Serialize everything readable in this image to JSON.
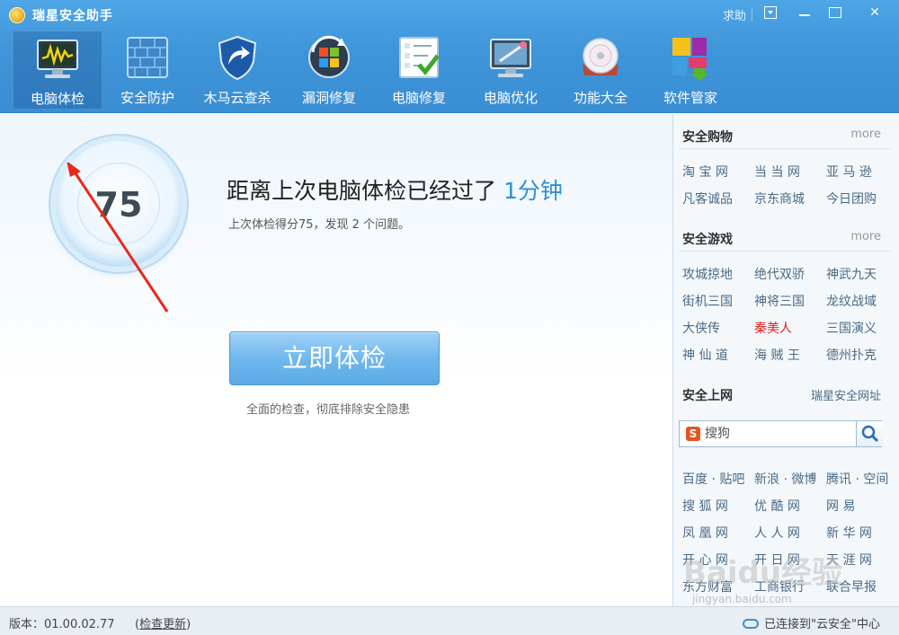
{
  "window": {
    "title": "瑞星安全助手",
    "help_label": "求助"
  },
  "toolbar": {
    "items": [
      {
        "label": "电脑体检",
        "icon": "monitor-checkup-icon"
      },
      {
        "label": "安全防护",
        "icon": "firewall-icon"
      },
      {
        "label": "木马云查杀",
        "icon": "shield-icon"
      },
      {
        "label": "漏洞修复",
        "icon": "windows-refresh-icon"
      },
      {
        "label": "电脑修复",
        "icon": "checklist-icon"
      },
      {
        "label": "电脑优化",
        "icon": "optimize-monitor-icon"
      },
      {
        "label": "功能大全",
        "icon": "disc-icon"
      },
      {
        "label": "软件管家",
        "icon": "software-blocks-icon"
      }
    ]
  },
  "checkup": {
    "score": "75",
    "headline_prefix": "距离上次电脑体检已经过了",
    "headline_time": "1分钟",
    "subline": "上次体检得分75，发现 2 个问题。",
    "button_label": "立即体检",
    "hint": "全面的检查，彻底排除安全隐患"
  },
  "sidebar": {
    "shopping": {
      "title": "安全购物",
      "more": "more",
      "links": [
        "淘 宝 网",
        "当 当 网",
        "亚 马 逊",
        "凡客诚品",
        "京东商城",
        "今日团购"
      ]
    },
    "games": {
      "title": "安全游戏",
      "more": "more",
      "links": [
        "攻城掠地",
        "绝代双骄",
        "神武九天",
        "街机三国",
        "神将三国",
        "龙纹战域",
        "大侠传",
        "秦美人",
        "三国演义",
        "神 仙 道",
        "海 贼 王",
        "德州扑克"
      ]
    },
    "web": {
      "title": "安全上网",
      "site_link": "瑞星安全网址",
      "search_placeholder": "搜狗",
      "links": [
        "百度 · 贴吧",
        "新浪 · 微博",
        "腾讯 · 空间",
        "搜 狐 网",
        "优 酷 网",
        "网 易",
        "凤 凰 网",
        "人 人 网",
        "新 华 网",
        "开 心 网",
        "开 日 网",
        "天 涯 网",
        "东方财富",
        "工商银行",
        "联合早报"
      ]
    }
  },
  "status": {
    "version": "版本：01.00.02.77",
    "update_link": "检查更新",
    "connection": "已连接到\"云安全\"中心"
  },
  "watermark": {
    "brand": "Baidu经验",
    "url": "jingyan.baidu.com"
  },
  "colors": {
    "titlebar": "#3f95d9",
    "accent": "#2d8fd6",
    "annotation_arrow": "#e8291c",
    "game_highlight": "#e02020"
  }
}
